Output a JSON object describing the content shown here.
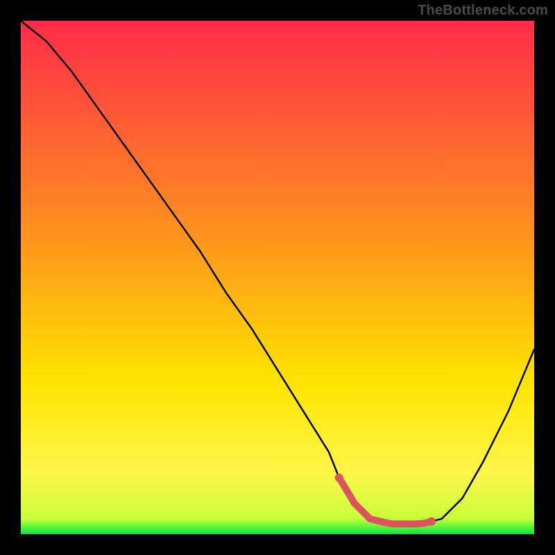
{
  "attribution": "TheBottleneck.com",
  "colors": {
    "background": "#000000",
    "gradient_top": "#ff2b4a",
    "gradient_mid": "#ffce00",
    "gradient_low": "#fff64a",
    "gradient_bottom": "#00e83c",
    "curve": "#000000",
    "optimal_stroke": "#d9575c",
    "optimal_fill": "#d9575c"
  },
  "chart_data": {
    "type": "line",
    "title": "",
    "xlabel": "",
    "ylabel": "",
    "xlim": [
      0,
      100
    ],
    "ylim": [
      0,
      100
    ],
    "series": [
      {
        "name": "bottleneck-curve",
        "x": [
          0,
          5,
          10,
          15,
          20,
          25,
          30,
          35,
          40,
          45,
          50,
          55,
          60,
          62,
          65,
          68,
          72,
          75,
          78,
          82,
          86,
          90,
          95,
          100
        ],
        "values": [
          100,
          96,
          90,
          83,
          76,
          69,
          62,
          55,
          47,
          40,
          32,
          24,
          16,
          11,
          6,
          3,
          2,
          2,
          2,
          3,
          7,
          14,
          24,
          36
        ]
      }
    ],
    "annotations": [
      {
        "name": "optimal-range",
        "x_start": 62,
        "x_end": 80,
        "y": 2
      }
    ]
  }
}
